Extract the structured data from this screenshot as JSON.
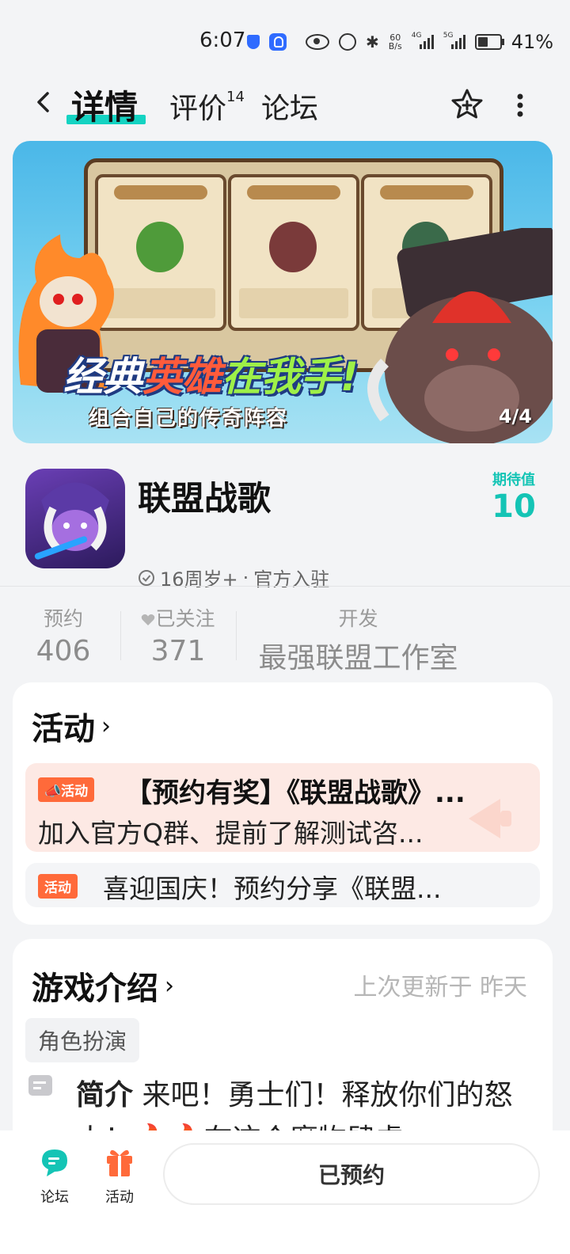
{
  "status_bar": {
    "time": "6:07",
    "net_speed_value": "60",
    "net_speed_unit": "B/s",
    "signal_1": "4G",
    "signal_2": "5G",
    "battery": "41%"
  },
  "nav": {
    "tab_detail": "详情",
    "tab_review": "评价",
    "review_count": "14",
    "tab_forum": "论坛"
  },
  "banner": {
    "headline_part1": "经典",
    "headline_part2": "英雄",
    "headline_part3": "在我手!",
    "subline": "组合自己的传奇阵容",
    "counter": "4/4"
  },
  "app": {
    "name": "联盟战歌",
    "expect_label": "期待值",
    "expect_value": "10",
    "age_rating": "16周岁+",
    "meta_sep": "·",
    "official": "官方入驻"
  },
  "stats": {
    "reserve_label": "预约",
    "reserve_value": "406",
    "follow_label": "已关注",
    "follow_value": "371",
    "dev_label": "开发",
    "dev_value": "最强联盟工作室"
  },
  "activity": {
    "title": "活动",
    "items": [
      {
        "tag": "活动",
        "title": "【预约有奖】《联盟战歌》...",
        "desc": "加入官方Q群、提前了解测试咨..."
      },
      {
        "tag": "活动",
        "title": "喜迎国庆！预约分享《联盟..."
      }
    ]
  },
  "intro": {
    "title": "游戏介绍",
    "updated": "上次更新于 昨天",
    "genre": "角色扮演",
    "label": "简介",
    "text": "来吧！勇士们！释放你们的怒火！🔥🔥在这个魔物肆虐"
  },
  "bottom": {
    "forum_label": "论坛",
    "activity_label": "活动",
    "reserved_label": "已预约"
  },
  "colors": {
    "accent": "#14c4b5",
    "promo_tag": "#ff6a3a",
    "background": "#f3f4f6"
  }
}
